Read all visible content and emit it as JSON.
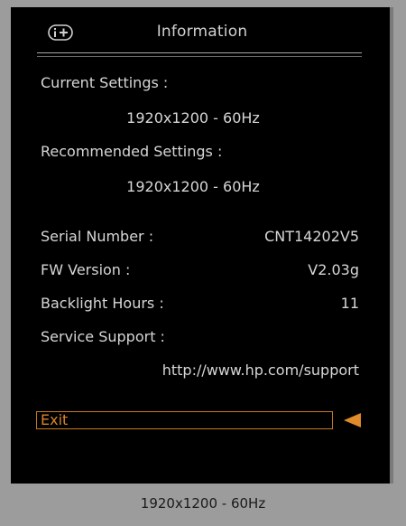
{
  "header": {
    "icon": "info-plus-icon",
    "title": "Information"
  },
  "current_settings": {
    "label": "Current Settings :",
    "value": "1920x1200 - 60Hz"
  },
  "recommended_settings": {
    "label": "Recommended Settings :",
    "value": "1920x1200 - 60Hz"
  },
  "serial_number": {
    "label": "Serial Number :",
    "value": "CNT14202V5"
  },
  "fw_version": {
    "label": "FW Version :",
    "value": "V2.03g"
  },
  "backlight_hours": {
    "label": "Backlight Hours :",
    "value": "11"
  },
  "service_support": {
    "label": "Service Support :",
    "value": "http://www.hp.com/support"
  },
  "exit": {
    "label": "Exit",
    "selected": true
  },
  "status_bar": {
    "text": "1920x1200 - 60Hz"
  },
  "colors": {
    "osd_background": "#000000",
    "text": "#d6d6d6",
    "highlight": "#d9822b",
    "bezel": "#9c9c9c"
  }
}
